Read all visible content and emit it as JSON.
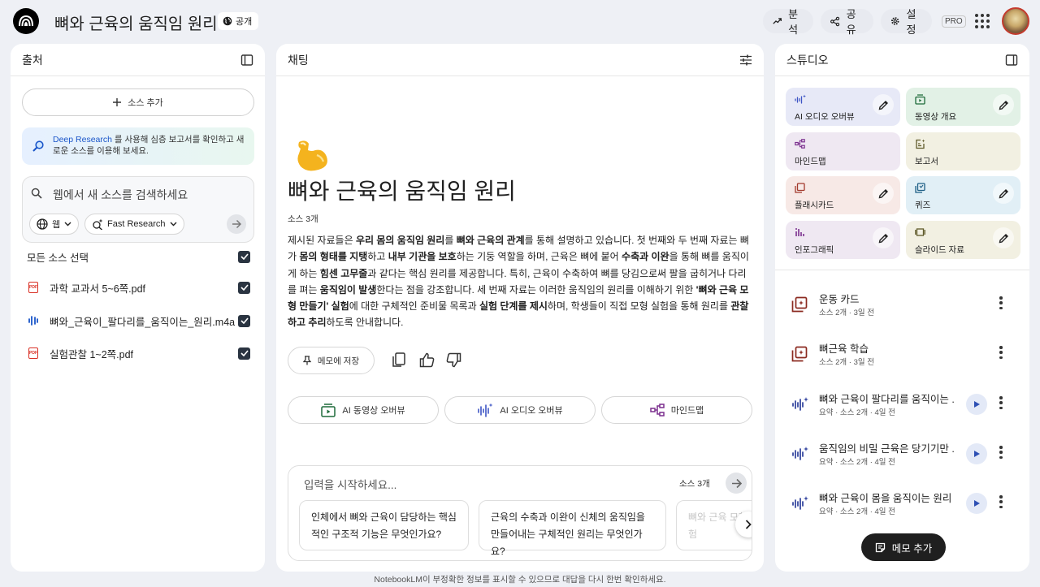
{
  "app": {
    "notebook_title": "뼈와 근육의 움직임 원리",
    "visibility_label": "공개",
    "analysis_label": "분석",
    "share_label": "공유",
    "settings_label": "설정",
    "tier_badge": "PRO"
  },
  "sources_panel": {
    "title": "출처",
    "add_source_label": "소스 추가",
    "deep_research_link": "Deep Research",
    "deep_research_text": "를 사용해 심층 보고서를 확인하고 새로운 소스를 이용해 보세요.",
    "search_placeholder": "웹에서 새 소스를 검색하세요",
    "web_filter_label": "웹",
    "research_mode_label": "Fast Research",
    "select_all_label": "모든 소스 선택",
    "items": [
      {
        "label": "과학 교과서 5~6쪽.pdf",
        "type": "pdf",
        "checked": true
      },
      {
        "label": "뼈와_근육이_팔다리를_움직이는_원리.m4a",
        "type": "audio",
        "checked": true
      },
      {
        "label": "실험관찰 1~2쪽.pdf",
        "type": "pdf",
        "checked": true
      }
    ]
  },
  "chat_panel": {
    "title": "채팅",
    "emoji": "💪",
    "heading": "뼈와 근육의 움직임 원리",
    "source_count": "소스 3개",
    "summary": {
      "s1": "제시된 자료들은 ",
      "b1": "우리 몸의 움직임 원리",
      "s2": "를 ",
      "b2": "뼈와 근육의 관계",
      "s3": "를 통해 설명하고 있습니다. 첫 번째와 두 번째 자료는 뼈가 ",
      "b3": "몸의 형태를 지탱",
      "s4": "하고 ",
      "b4": "내부 기관을 보호",
      "s5": "하는 기둥 역할을 하며, 근육은 뼈에 붙어 ",
      "b5": "수축과 이완",
      "s6": "을 통해 뼈를 움직이게 하는 ",
      "b6": "힘센 고무줄",
      "s7": "과 같다는 핵심 원리를 제공합니다. 특히, 근육이 수축하여 뼈를 당김으로써 팔을 굽히거나 다리를 펴는 ",
      "b7": "움직임이 발생",
      "s8": "한다는 점을 강조합니다. 세 번째 자료는 이러한 움직임의 원리를 이해하기 위한 ",
      "b8": "'뼈와 근육 모형 만들기' 실험",
      "s9": "에 대한 구체적인 준비물 목록과 ",
      "b9": "실험 단계를 제시",
      "s10": "하며, 학생들이 직접 모형 실험을 통해 원리를 ",
      "b10": "관찰하고 추리",
      "s11": "하도록 안내합니다."
    },
    "save_memo_label": "메모에 저장",
    "overview_buttons": [
      {
        "label": "AI 동영상 오버뷰"
      },
      {
        "label": "AI 오디오 오버뷰"
      },
      {
        "label": "마인드맵"
      }
    ],
    "input_placeholder": "입력을 시작하세요...",
    "input_source_count": "소스 3개",
    "suggestions": [
      "인체에서 뼈와 근육이 담당하는 핵심적인 구조적 기능은 무엇인가요?",
      "근육의 수축과 이완이 신체의 움직임을 만들어내는 구체적인 원리는 무엇인가요?",
      "뼈와 근육 모형 실험"
    ]
  },
  "studio_panel": {
    "title": "스튜디오",
    "tiles": [
      {
        "label": "AI 오디오 오버뷰",
        "bg": "#e7e9f7",
        "editable": true,
        "icon": "audio-sparkle-icon"
      },
      {
        "label": "동영상 개요",
        "bg": "#e2f1e6",
        "editable": true,
        "icon": "video-icon"
      },
      {
        "label": "마인드맵",
        "bg": "#efe8f2",
        "editable": false,
        "icon": "mindmap-icon"
      },
      {
        "label": "보고서",
        "bg": "#f2f0e2",
        "editable": false,
        "icon": "report-icon"
      },
      {
        "label": "플래시카드",
        "bg": "#f7e9e6",
        "editable": true,
        "icon": "flashcard-icon"
      },
      {
        "label": "퀴즈",
        "bg": "#e1eff6",
        "editable": true,
        "icon": "quiz-icon"
      },
      {
        "label": "인포그래픽",
        "bg": "#efe8f2",
        "editable": true,
        "icon": "infographic-icon"
      },
      {
        "label": "슬라이드 자료",
        "bg": "#f2f0e2",
        "editable": true,
        "icon": "slides-icon"
      }
    ],
    "notes": [
      {
        "title": "운동 카드",
        "meta": "소스 2개 · 3일 전",
        "kind": "flashcard",
        "playable": false
      },
      {
        "title": "뼈근육 학습",
        "meta": "소스 2개 · 3일 전",
        "kind": "flashcard",
        "playable": false
      },
      {
        "title": "뼈와 근육이 팔다리를 움직이는 ...",
        "meta": "요약 · 소스 2개 · 4일 전",
        "kind": "audio",
        "playable": true
      },
      {
        "title": "움직임의 비밀 근육은 당기기만 ...",
        "meta": "요약 · 소스 2개 · 4일 전",
        "kind": "audio",
        "playable": true
      },
      {
        "title": "뼈와 근육이 몸을 움직이는 원리",
        "meta": "요약 · 소스 2개 · 4일 전",
        "kind": "audio",
        "playable": true
      }
    ],
    "add_memo_label": "메모 추가"
  },
  "footer": {
    "disclaimer": "NotebookLM이 부정확한 정보를 표시할 수 있으므로 대답을 다시 한번 확인하세요."
  }
}
